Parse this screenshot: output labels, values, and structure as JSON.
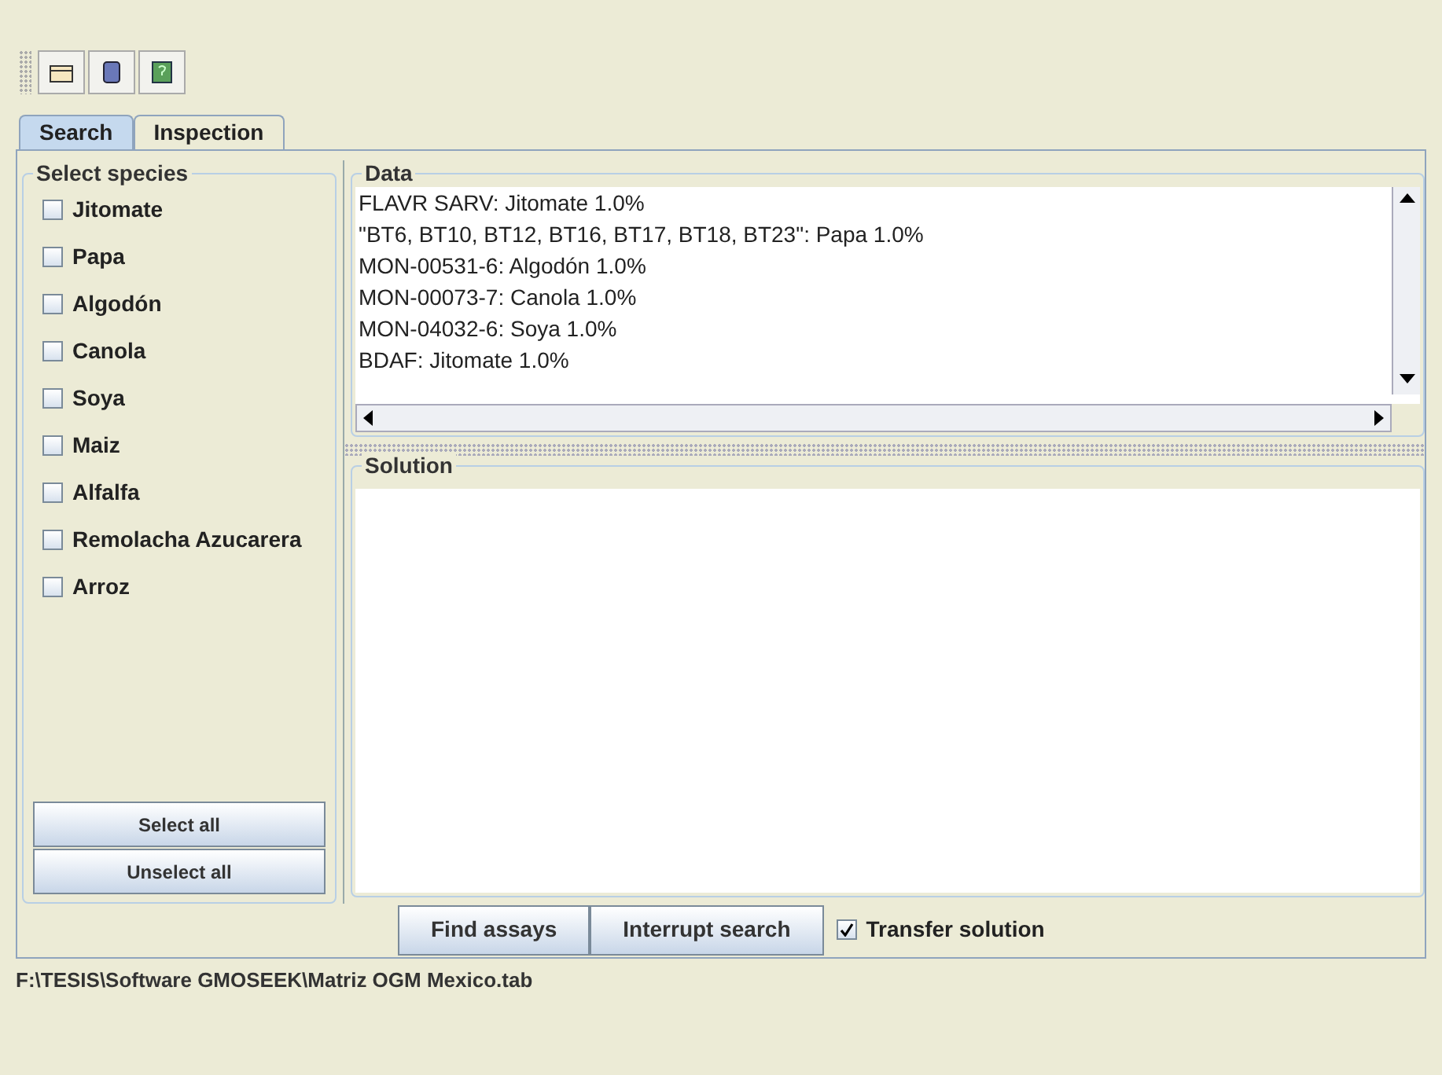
{
  "tabs": [
    {
      "label": "Search",
      "selected": true
    },
    {
      "label": "Inspection",
      "selected": false
    }
  ],
  "species": {
    "title": "Select species",
    "items": [
      {
        "label": "Jitomate",
        "checked": false
      },
      {
        "label": "Papa",
        "checked": false
      },
      {
        "label": "Algodón",
        "checked": false
      },
      {
        "label": "Canola",
        "checked": false
      },
      {
        "label": "Soya",
        "checked": false
      },
      {
        "label": "Maiz",
        "checked": false
      },
      {
        "label": "Alfalfa",
        "checked": false
      },
      {
        "label": "Remolacha Azucarera",
        "checked": false
      },
      {
        "label": "Arroz",
        "checked": false
      }
    ],
    "buttons": [
      "Select all",
      "Unselect all"
    ]
  },
  "data": {
    "title": "Data",
    "lines": [
      "FLAVR SARV: Jitomate 1.0%",
      "\"BT6, BT10, BT12, BT16, BT17, BT18, BT23\": Papa 1.0%",
      "MON-00531-6: Algodón 1.0%",
      "MON-00073-7: Canola 1.0%",
      "MON-04032-6: Soya 1.0%",
      "BDAF: Jitomate 1.0%"
    ]
  },
  "solution": {
    "title": "Solution"
  },
  "actions": {
    "buttons": [
      "Find assays",
      "Interrupt search"
    ],
    "transfer": {
      "label": "Transfer solution",
      "checked": true
    }
  },
  "status_bar": "F:\\TESIS\\Software GMOSEEK\\Matriz OGM Mexico.tab"
}
